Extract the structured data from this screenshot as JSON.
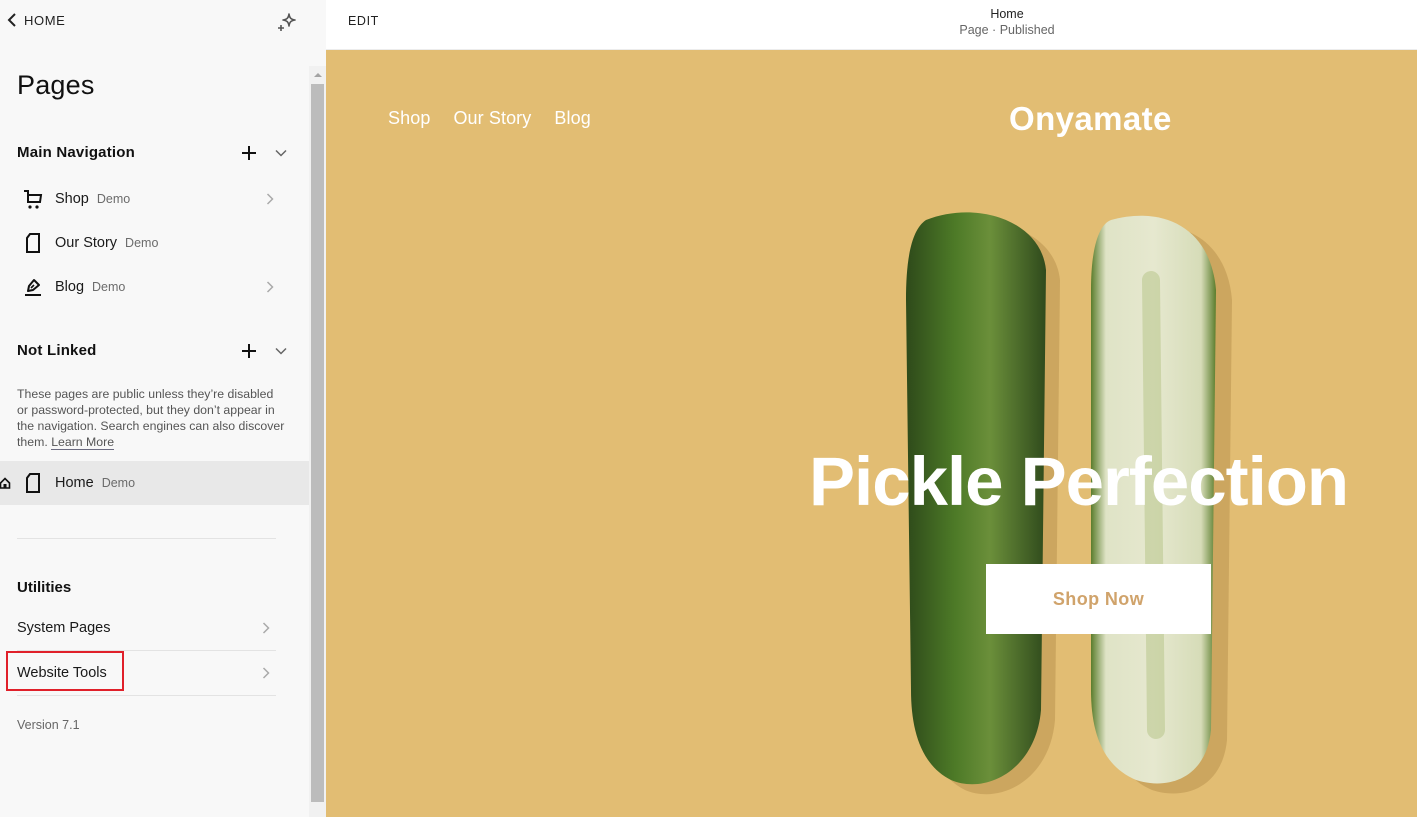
{
  "sidebar": {
    "back_label": "HOME",
    "title": "Pages",
    "main_navigation": {
      "label": "Main Navigation",
      "items": [
        {
          "name": "Shop",
          "tag": "Demo",
          "icon": "cart-icon",
          "has_arrow": true
        },
        {
          "name": "Our Story",
          "tag": "Demo",
          "icon": "page-icon",
          "has_arrow": false
        },
        {
          "name": "Blog",
          "tag": "Demo",
          "icon": "blog-pen-icon",
          "has_arrow": true
        }
      ]
    },
    "not_linked": {
      "label": "Not Linked",
      "description": "These pages are public unless they’re disabled or password-protected, but they don’t appear in the navigation. Search engines can also discover them.",
      "learn_more": "Learn More",
      "items": [
        {
          "name": "Home",
          "tag": "Demo",
          "icon": "page-icon",
          "is_homepage": true,
          "active": true
        }
      ]
    },
    "utilities": {
      "label": "Utilities",
      "items": [
        {
          "name": "System Pages"
        },
        {
          "name": "Website Tools",
          "highlighted": true
        }
      ]
    },
    "version": "Version 7.1"
  },
  "topbar": {
    "edit_label": "EDIT",
    "page_name": "Home",
    "page_status": "Page · Published"
  },
  "preview": {
    "nav": [
      "Shop",
      "Our Story",
      "Blog"
    ],
    "brand": "Onyamate",
    "headline": "Pickle Perfection",
    "cta": "Shop Now",
    "colors": {
      "background": "#e2bd73",
      "cta_text": "#d0a36b",
      "highlight_border": "#e0202a"
    }
  }
}
